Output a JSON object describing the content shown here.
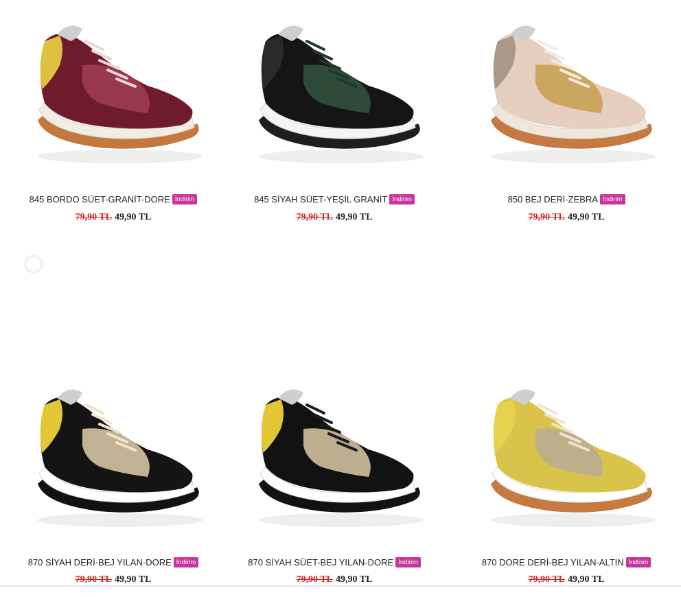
{
  "products": [
    {
      "name": "845 BORDO SÜET-GRANİT-DORE",
      "badge": "İndirim",
      "old_price": "79,90 TL",
      "new_price": "49,90 TL",
      "colors": {
        "upper": "#6e1c2c",
        "accent": "#9a3a4e",
        "heel": "#e0c040",
        "sole": "#f2ede4",
        "outsole": "#c4783e",
        "lace": "#e9d6da"
      }
    },
    {
      "name": "845 SİYAH SÜET-YEŞİL GRANİT",
      "badge": "İndirim",
      "old_price": "79,90 TL",
      "new_price": "49,90 TL",
      "colors": {
        "upper": "#151515",
        "accent": "#2f4d3a",
        "heel": "#2a2a2a",
        "sole": "#f4f4f4",
        "outsole": "#1e1e1e",
        "lace": "#1f3a2a"
      }
    },
    {
      "name": "850 BEJ DERİ-ZEBRA",
      "badge": "İndirim",
      "old_price": "79,90 TL",
      "new_price": "49,90 TL",
      "colors": {
        "upper": "#e6cfbf",
        "accent": "#c9a35a",
        "heel": "#a9998b",
        "sole": "#efe6dc",
        "outsole": "#c47a40",
        "lace": "#f3ece4"
      }
    },
    {
      "name": "870 SİYAH DERİ-BEJ YILAN-DORE",
      "badge": "İndirim",
      "old_price": "79,90 TL",
      "new_price": "49,90 TL",
      "colors": {
        "upper": "#141414",
        "accent": "#c9bb9a",
        "heel": "#e2c636",
        "sole": "#ffffff",
        "outsole": "#121212",
        "lace": "#efe3cc"
      }
    },
    {
      "name": "870 SİYAH SÜET-BEJ YILAN-DORE",
      "badge": "İndirim",
      "old_price": "79,90 TL",
      "new_price": "49,90 TL",
      "colors": {
        "upper": "#121212",
        "accent": "#c7b896",
        "heel": "#e2c636",
        "sole": "#ffffff",
        "outsole": "#121212",
        "lace": "#1a1a1a"
      }
    },
    {
      "name": "870 DORE DERİ-BEJ YILAN-ALTIN",
      "badge": "İndirim",
      "old_price": "79,90 TL",
      "new_price": "49,90 TL",
      "colors": {
        "upper": "#d9c34a",
        "accent": "#bcae8c",
        "heel": "#e6d24e",
        "sole": "#ffffff",
        "outsole": "#c47a40",
        "lace": "#efe3cc"
      }
    }
  ]
}
